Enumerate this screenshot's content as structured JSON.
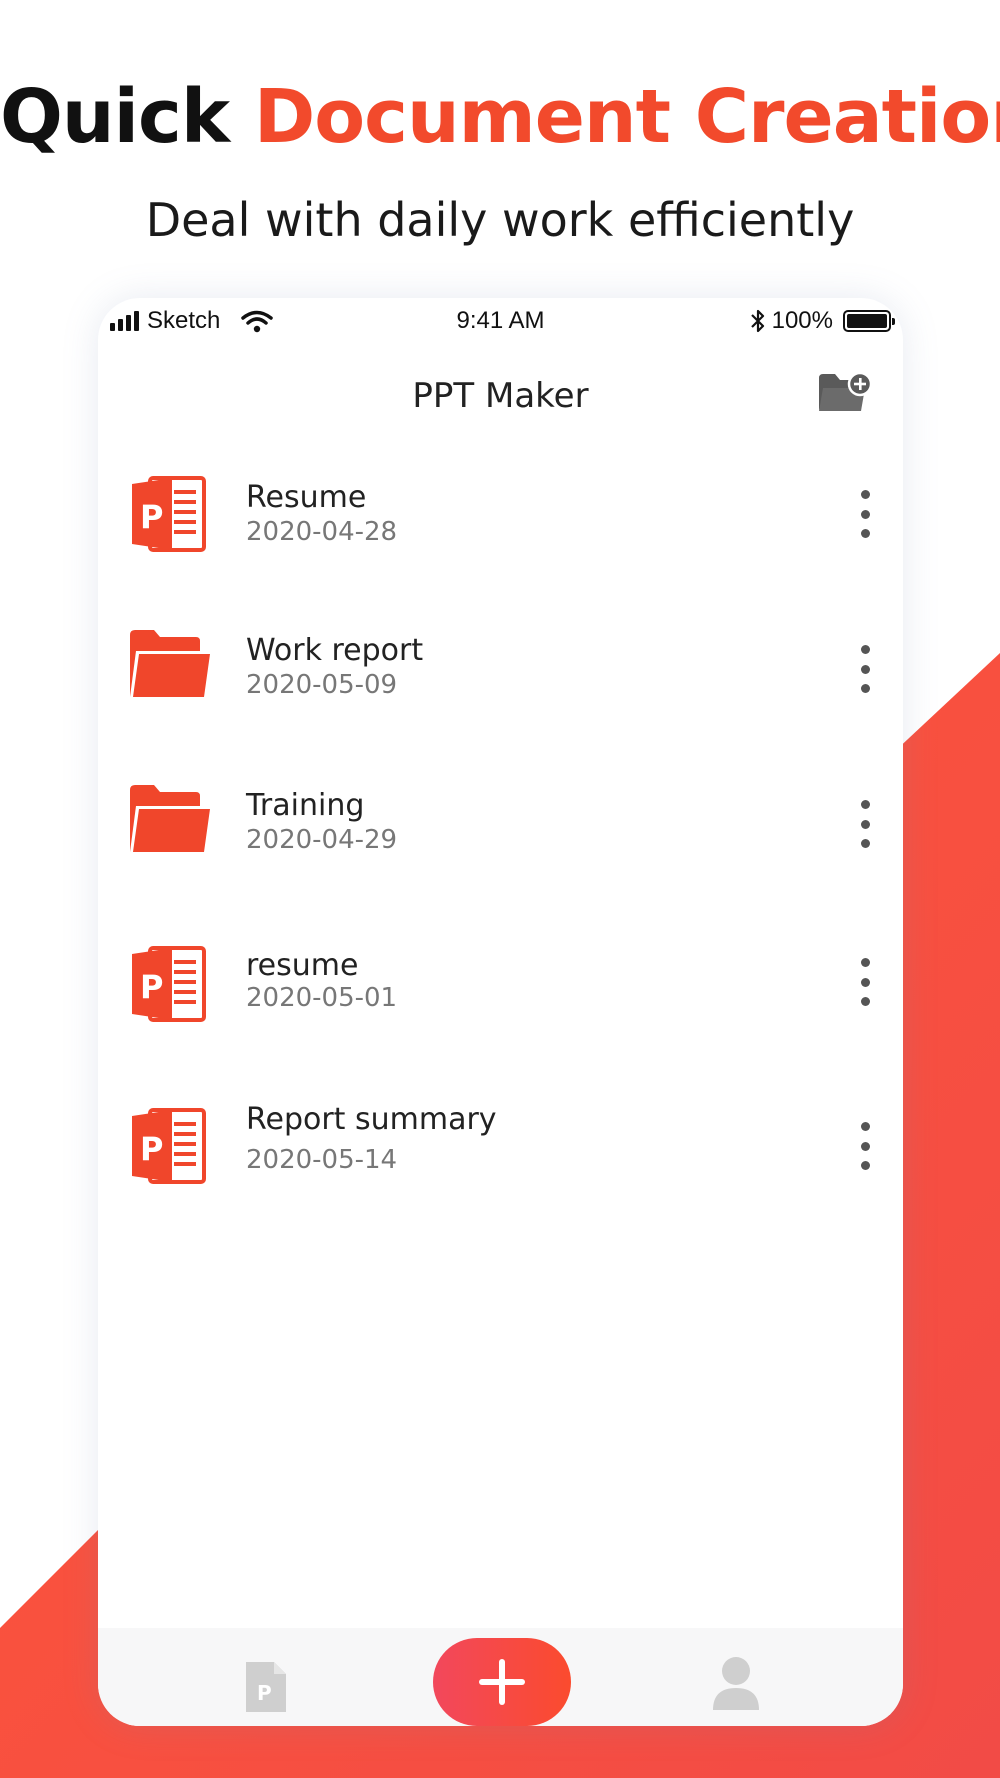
{
  "headline": {
    "part1": "Quick",
    "part2": "Document Creation"
  },
  "subheadline": "Deal with daily work efficiently",
  "colors": {
    "accent": "#f24a2c",
    "background_shape": "#fa4d3a",
    "text_dark": "#222222",
    "text_muted": "#777777",
    "icon_gray": "#555555"
  },
  "status_bar": {
    "carrier": "Sketch",
    "time": "9:41 AM",
    "battery": "100%"
  },
  "app": {
    "title": "PPT Maker",
    "new_folder_icon": "folder-plus-icon",
    "items": [
      {
        "type": "ppt",
        "icon": "powerpoint-file-icon",
        "name": "Resume",
        "date": "2020-04-28"
      },
      {
        "type": "folder",
        "icon": "folder-icon",
        "name": "Work report",
        "date": "2020-05-09"
      },
      {
        "type": "folder",
        "icon": "folder-icon",
        "name": "Training",
        "date": "2020-04-29"
      },
      {
        "type": "ppt",
        "icon": "powerpoint-file-icon",
        "name": "resume",
        "date": "2020-05-01"
      },
      {
        "type": "ppt",
        "icon": "powerpoint-file-icon",
        "name": "Report summary",
        "date": "2020-05-14"
      }
    ]
  },
  "tab_bar": {
    "left_icon": "document-tab-icon",
    "center_icon": "plus-icon",
    "right_icon": "profile-icon"
  }
}
